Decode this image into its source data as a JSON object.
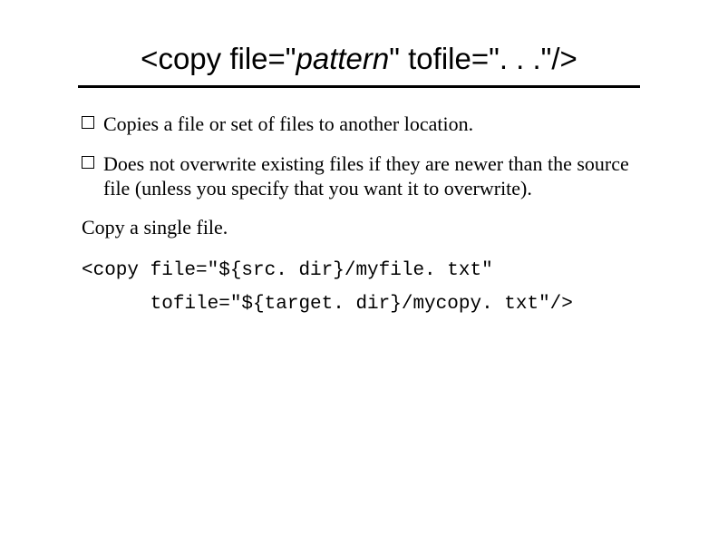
{
  "title": {
    "prefix": "<copy file=\"",
    "italic": "pattern",
    "suffix": "\" tofile=\". . .\"/>"
  },
  "bullets": [
    "Copies a file or set of files to another location.",
    "Does not overwrite existing files if they are newer than the source file (unless you specify that you want it to overwrite)."
  ],
  "plainText": "Copy a single file.",
  "codeLines": [
    "<copy file=\"${src. dir}/myfile. txt\"",
    "      tofile=\"${target. dir}/mycopy. txt\"/>"
  ]
}
